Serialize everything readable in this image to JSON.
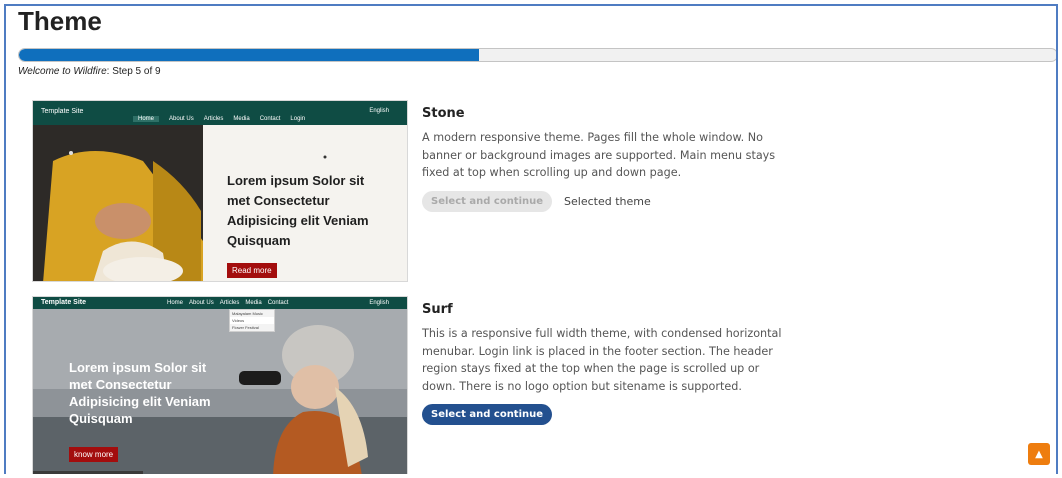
{
  "page": {
    "title": "Theme",
    "progress_percent": 44.3,
    "step_site_name": "Welcome to Wildfire",
    "step_text": ": Step 5 of 9"
  },
  "colors": {
    "progress_fill": "#0f6fbd",
    "primary_button": "#23508f",
    "disabled_button": "#e6e6e6",
    "scroll_top": "#ee7d0f",
    "thumb_nav": "#0f4c44",
    "thumb_button": "#a30d0d"
  },
  "themes": [
    {
      "name": "Stone",
      "description": "A modern responsive theme. Pages fill the whole window. No banner or background images are supported. Main menu stays fixed at top when scrolling up and down page.",
      "button_label": "Select and continue",
      "button_disabled": true,
      "status": "Selected theme",
      "thumb": {
        "site_name": "Template Site",
        "language": "English",
        "menu": [
          "Home",
          "About Us",
          "Articles",
          "Media",
          "Contact",
          "Login"
        ],
        "caption": "Lorem ipsum Solor sit met Consectetur Adipisicing elit Veniam Quisquam",
        "button": "Read more"
      }
    },
    {
      "name": "Surf",
      "description": "This is a responsive full width theme, with condensed horizontal menubar. Login link is placed in the footer section. The header region stays fixed at the top when the page is scrolled up or down. There is no logo option but sitename is supported.",
      "button_label": "Select and continue",
      "button_disabled": false,
      "thumb": {
        "site_name": "Template Site",
        "language": "English",
        "menu": [
          "Home",
          "About Us",
          "Articles",
          "Media",
          "Contact"
        ],
        "dropdown": [
          "Malayalam Music",
          "Videos",
          "Flower Festival"
        ],
        "caption": "Lorem ipsum Solor sit met Consectetur Adipisicing elit Veniam Quisquam",
        "button": "know more"
      }
    }
  ],
  "scroll_top_icon": "chevron-up-icon"
}
